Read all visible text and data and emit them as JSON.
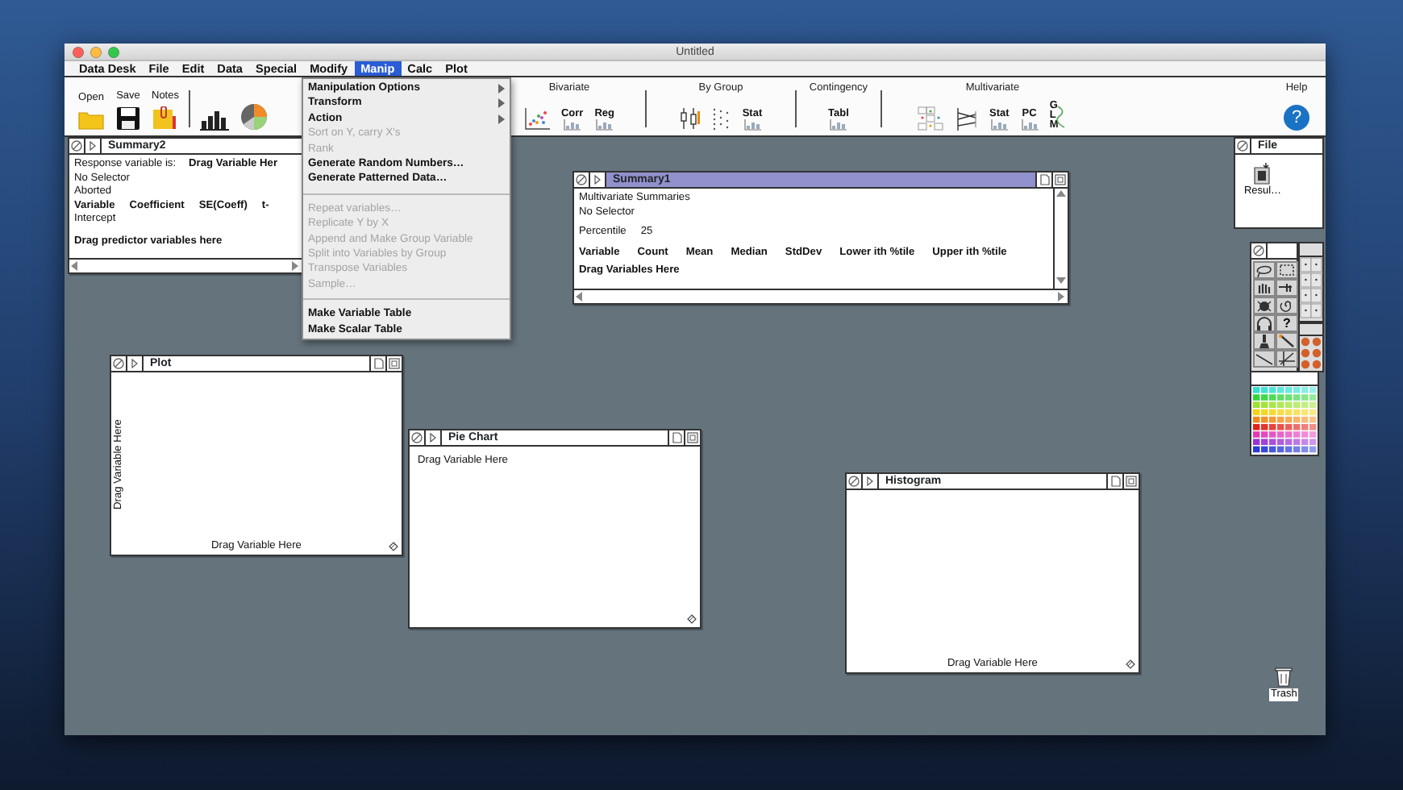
{
  "window": {
    "title": "Untitled"
  },
  "menu_bar": [
    {
      "label": "Data Desk",
      "selected": false
    },
    {
      "label": "File",
      "selected": false
    },
    {
      "label": "Edit",
      "selected": false
    },
    {
      "label": "Data",
      "selected": false
    },
    {
      "label": "Special",
      "selected": false
    },
    {
      "label": "Modify",
      "selected": false
    },
    {
      "label": "Manip",
      "selected": true
    },
    {
      "label": "Calc",
      "selected": false
    },
    {
      "label": "Plot",
      "selected": false
    }
  ],
  "toolbar": {
    "groups": [
      {
        "kind": "file",
        "buttons": [
          {
            "kind": "folder",
            "label": "Open"
          },
          {
            "kind": "disk",
            "label": "Save"
          },
          {
            "kind": "notes",
            "label": "Notes"
          }
        ]
      },
      {
        "kind": "charts",
        "buttons": [
          {
            "kind": "barchart"
          },
          {
            "kind": "piechart"
          }
        ]
      },
      {
        "kind": "analysis",
        "label": "Bivariate",
        "buttons": [
          {
            "kind": "scatter"
          },
          {
            "kind": "textchart",
            "label": "Corr"
          },
          {
            "kind": "textchart",
            "label": "Reg"
          }
        ]
      },
      {
        "kind": "analysis",
        "label": "By Group",
        "buttons": [
          {
            "kind": "boxplots"
          },
          {
            "kind": "dotplots"
          },
          {
            "kind": "textchart",
            "label": "Stat"
          }
        ]
      },
      {
        "kind": "analysis",
        "label": "Contingency",
        "buttons": [
          {
            "kind": "textchart",
            "label": "Tabl"
          }
        ]
      },
      {
        "kind": "analysis",
        "label": "Multivariate",
        "buttons": [
          {
            "kind": "matrix"
          },
          {
            "kind": "parallel"
          },
          {
            "kind": "textchart",
            "label": "Stat"
          },
          {
            "kind": "textchart",
            "label": "PC"
          },
          {
            "kind": "stacked",
            "label": "GLM"
          }
        ]
      },
      {
        "kind": "help",
        "label": "Help",
        "buttons": [
          {
            "kind": "help",
            "label": "?"
          }
        ]
      }
    ]
  },
  "manip_menu": {
    "items": [
      {
        "kind": "submenu",
        "label": "Manipulation Options",
        "disabled": false
      },
      {
        "kind": "submenu",
        "label": "Transform",
        "disabled": false
      },
      {
        "kind": "submenu",
        "label": "Action",
        "disabled": false
      },
      {
        "kind": "item",
        "label": "Sort on Y, carry X's",
        "disabled": true
      },
      {
        "kind": "item",
        "label": "Rank",
        "disabled": true
      },
      {
        "kind": "item",
        "label": "Generate Random Numbers…",
        "disabled": false
      },
      {
        "kind": "item",
        "label": "Generate Patterned Data…",
        "disabled": false
      },
      {
        "kind": "separator"
      },
      {
        "kind": "item",
        "label": "Repeat variables…",
        "disabled": true
      },
      {
        "kind": "item",
        "label": "Replicate Y by X",
        "disabled": true
      },
      {
        "kind": "item",
        "label": "Append and Make Group Variable",
        "disabled": true
      },
      {
        "kind": "item",
        "label": "Split into Variables by Group",
        "disabled": true
      },
      {
        "kind": "item",
        "label": "Transpose Variables",
        "disabled": true
      },
      {
        "kind": "item",
        "label": "Sample…",
        "disabled": true
      },
      {
        "kind": "separator"
      },
      {
        "kind": "item",
        "label": "Make Variable Table",
        "disabled": false
      },
      {
        "kind": "item",
        "label": "Make Scalar Table",
        "disabled": false
      }
    ]
  },
  "windows": [
    {
      "kind": "regression",
      "title": "Summary2",
      "active": false,
      "response_label": "Response variable is:",
      "response_value": "Drag Variable Her",
      "lines": [
        "No Selector",
        "Aborted"
      ],
      "columns": [
        "Variable",
        "Coefficient",
        "SE(Coeff)",
        "t-"
      ],
      "rows": [
        "Intercept"
      ],
      "footer": "Drag predictor variables here"
    },
    {
      "kind": "summaries",
      "title": "Summary1",
      "active": true,
      "lines": [
        "Multivariate Summaries",
        "No Selector"
      ],
      "percentile_label": "Percentile",
      "percentile_value": "25",
      "columns": [
        "Variable",
        "Count",
        "Mean",
        "Median",
        "StdDev",
        "Lower ith %tile",
        "Upper ith %tile"
      ],
      "footer": "Drag Variables Here"
    },
    {
      "kind": "scatterplot",
      "title": "Plot",
      "active": false,
      "y_prompt": "Drag Variable Here",
      "x_prompt": "Drag Variable Here"
    },
    {
      "kind": "piechart",
      "title": "Pie Chart",
      "active": false,
      "prompt": "Drag Variable Here"
    },
    {
      "kind": "histogram",
      "title": "Histogram",
      "active": false,
      "x_prompt": "Drag Variable Here"
    }
  ],
  "file_palette": {
    "title": "File",
    "items": [
      {
        "label": "Resul…"
      }
    ]
  },
  "tool_palette": {
    "tools": [
      {
        "kind": "lasso"
      },
      {
        "kind": "marquee"
      },
      {
        "kind": "hand"
      },
      {
        "kind": "point"
      },
      {
        "kind": "bug"
      },
      {
        "kind": "swirl"
      },
      {
        "kind": "headset"
      },
      {
        "kind": "help",
        "label": "?"
      },
      {
        "kind": "brush"
      },
      {
        "kind": "wand"
      },
      {
        "kind": "line"
      },
      {
        "kind": "axes"
      }
    ]
  },
  "trash": {
    "label": "Trash"
  }
}
